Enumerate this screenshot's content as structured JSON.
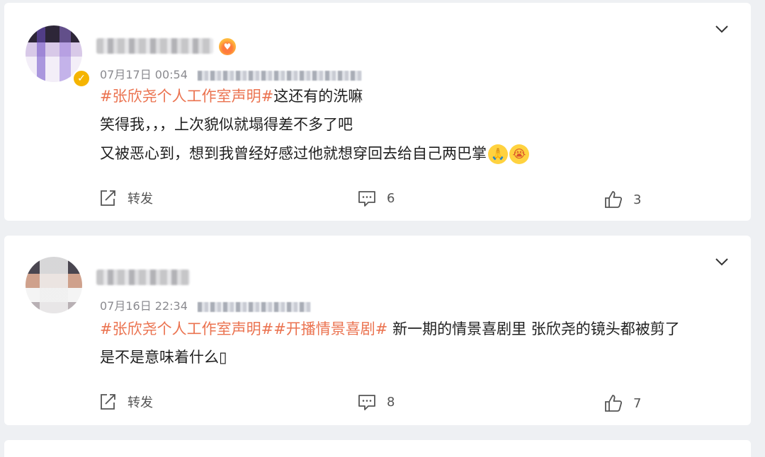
{
  "posts": [
    {
      "timestamp": "07月17日 00:54",
      "topics": "#张欣尧个人工作室声明#",
      "line1_rest": "这还有的洗嘛",
      "line2": "笑得我，，，上次貌似就塌得差不多了吧",
      "line3": "又被恶心到，想到我曾经好感过他就想穿回去给自己两巴掌",
      "emojis": [
        "pray-emoji",
        "crying-emoji"
      ],
      "actions": {
        "repost_label": "转发",
        "comment_count": "6",
        "like_count": "3"
      }
    },
    {
      "timestamp": "07月16日 22:34",
      "topics": "#张欣尧个人工作室声明##开播情景喜剧#",
      "line1_rest": " 新一期的情景喜剧里 张欣尧的镜头都被剪了",
      "line2": "是不是意味着什么▯",
      "actions": {
        "repost_label": "转发",
        "comment_count": "8",
        "like_count": "7"
      }
    }
  ],
  "colors": {
    "topic": "#eb7350",
    "text": "#1f1f1f",
    "meta": "#8a8a8f",
    "background": "#eef0f3",
    "card": "#ffffff"
  },
  "icons": [
    "chevron-down-icon",
    "repost-icon",
    "comment-icon",
    "like-icon",
    "verified-badge-icon"
  ]
}
